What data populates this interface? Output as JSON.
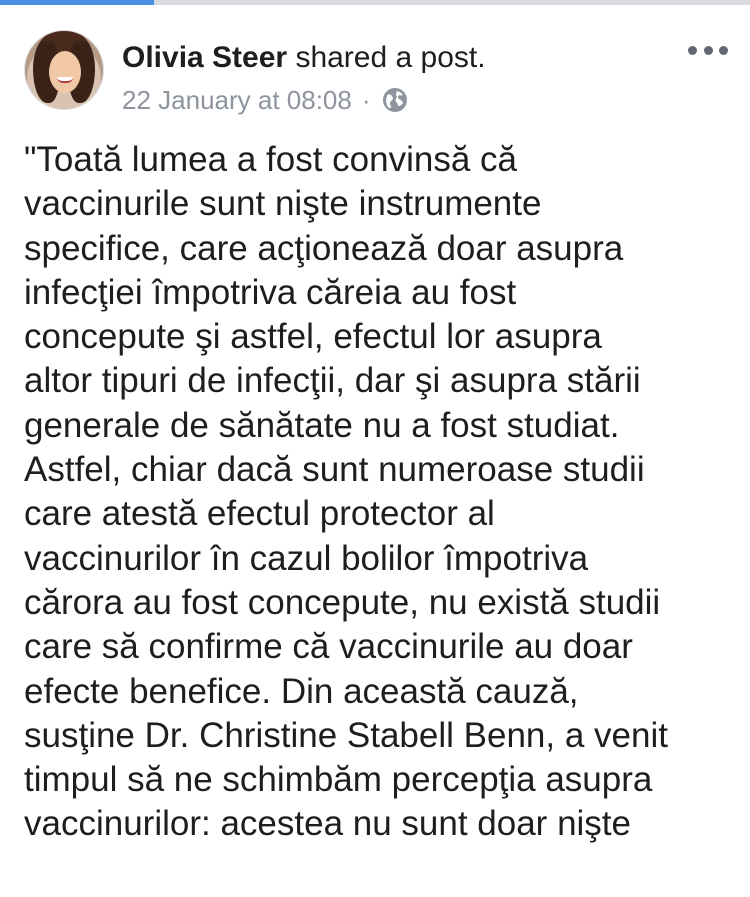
{
  "progress": {
    "value": 0.205,
    "fill_color": "#4a90e2",
    "track_color": "#d8dbe0"
  },
  "post": {
    "author": "Olivia Steer",
    "action": "shared a post.",
    "date": "22 January at 08:08",
    "separator": "·",
    "privacy_icon": "globe-icon",
    "more_icon": "more-dots-icon",
    "lines": [
      "\"Toată lumea a fost convinsă că",
      "vaccinurile sunt nişte instrumente",
      "specifice, care acţionează doar asupra",
      "infecţiei împotriva căreia au fost",
      "concepute şi astfel, efectul lor asupra",
      "altor tipuri de infecţii, dar şi asupra stării",
      "generale de sănătate nu a fost studiat.",
      "Astfel, chiar dacă sunt numeroase studii",
      "care atestă efectul protector al",
      "vaccinurilor în cazul bolilor împotriva",
      "cărora au fost concepute, nu există studii",
      "care să confirme că vaccinurile au doar",
      "efecte benefice. Din această cauză,",
      "susţine Dr. Christine Stabell Benn, a venit",
      "timpul să ne schimbăm percepţia asupra",
      "vaccinurilor: acestea nu sunt doar nişte"
    ]
  }
}
